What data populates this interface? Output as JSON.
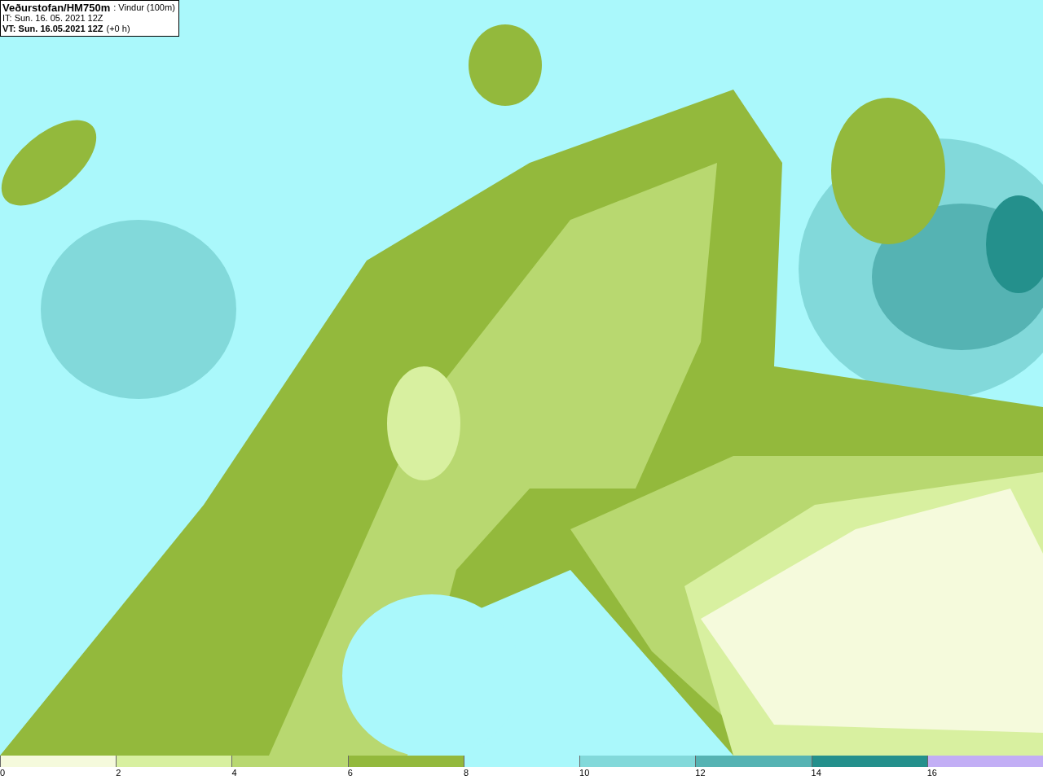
{
  "header": {
    "source": "Veðurstofan/HM750m",
    "field": ": Vindur (100m)",
    "issue_time": "IT: Sun. 16. 05. 2021 12Z",
    "valid_time": "VT: Sun. 16.05.2021 12Z",
    "offset": "(+0 h)"
  },
  "legend": [
    {
      "label": "0",
      "color": "#f5fadc"
    },
    {
      "label": "2",
      "color": "#d8f0a0"
    },
    {
      "label": "4",
      "color": "#b8d870"
    },
    {
      "label": "6",
      "color": "#93b93c"
    },
    {
      "label": "8",
      "color": "#aaf8fb"
    },
    {
      "label": "10",
      "color": "#82d9da"
    },
    {
      "label": "12",
      "color": "#55b3b3"
    },
    {
      "label": "14",
      "color": "#24908c"
    },
    {
      "label": "16",
      "color": "#c2aef5"
    }
  ]
}
